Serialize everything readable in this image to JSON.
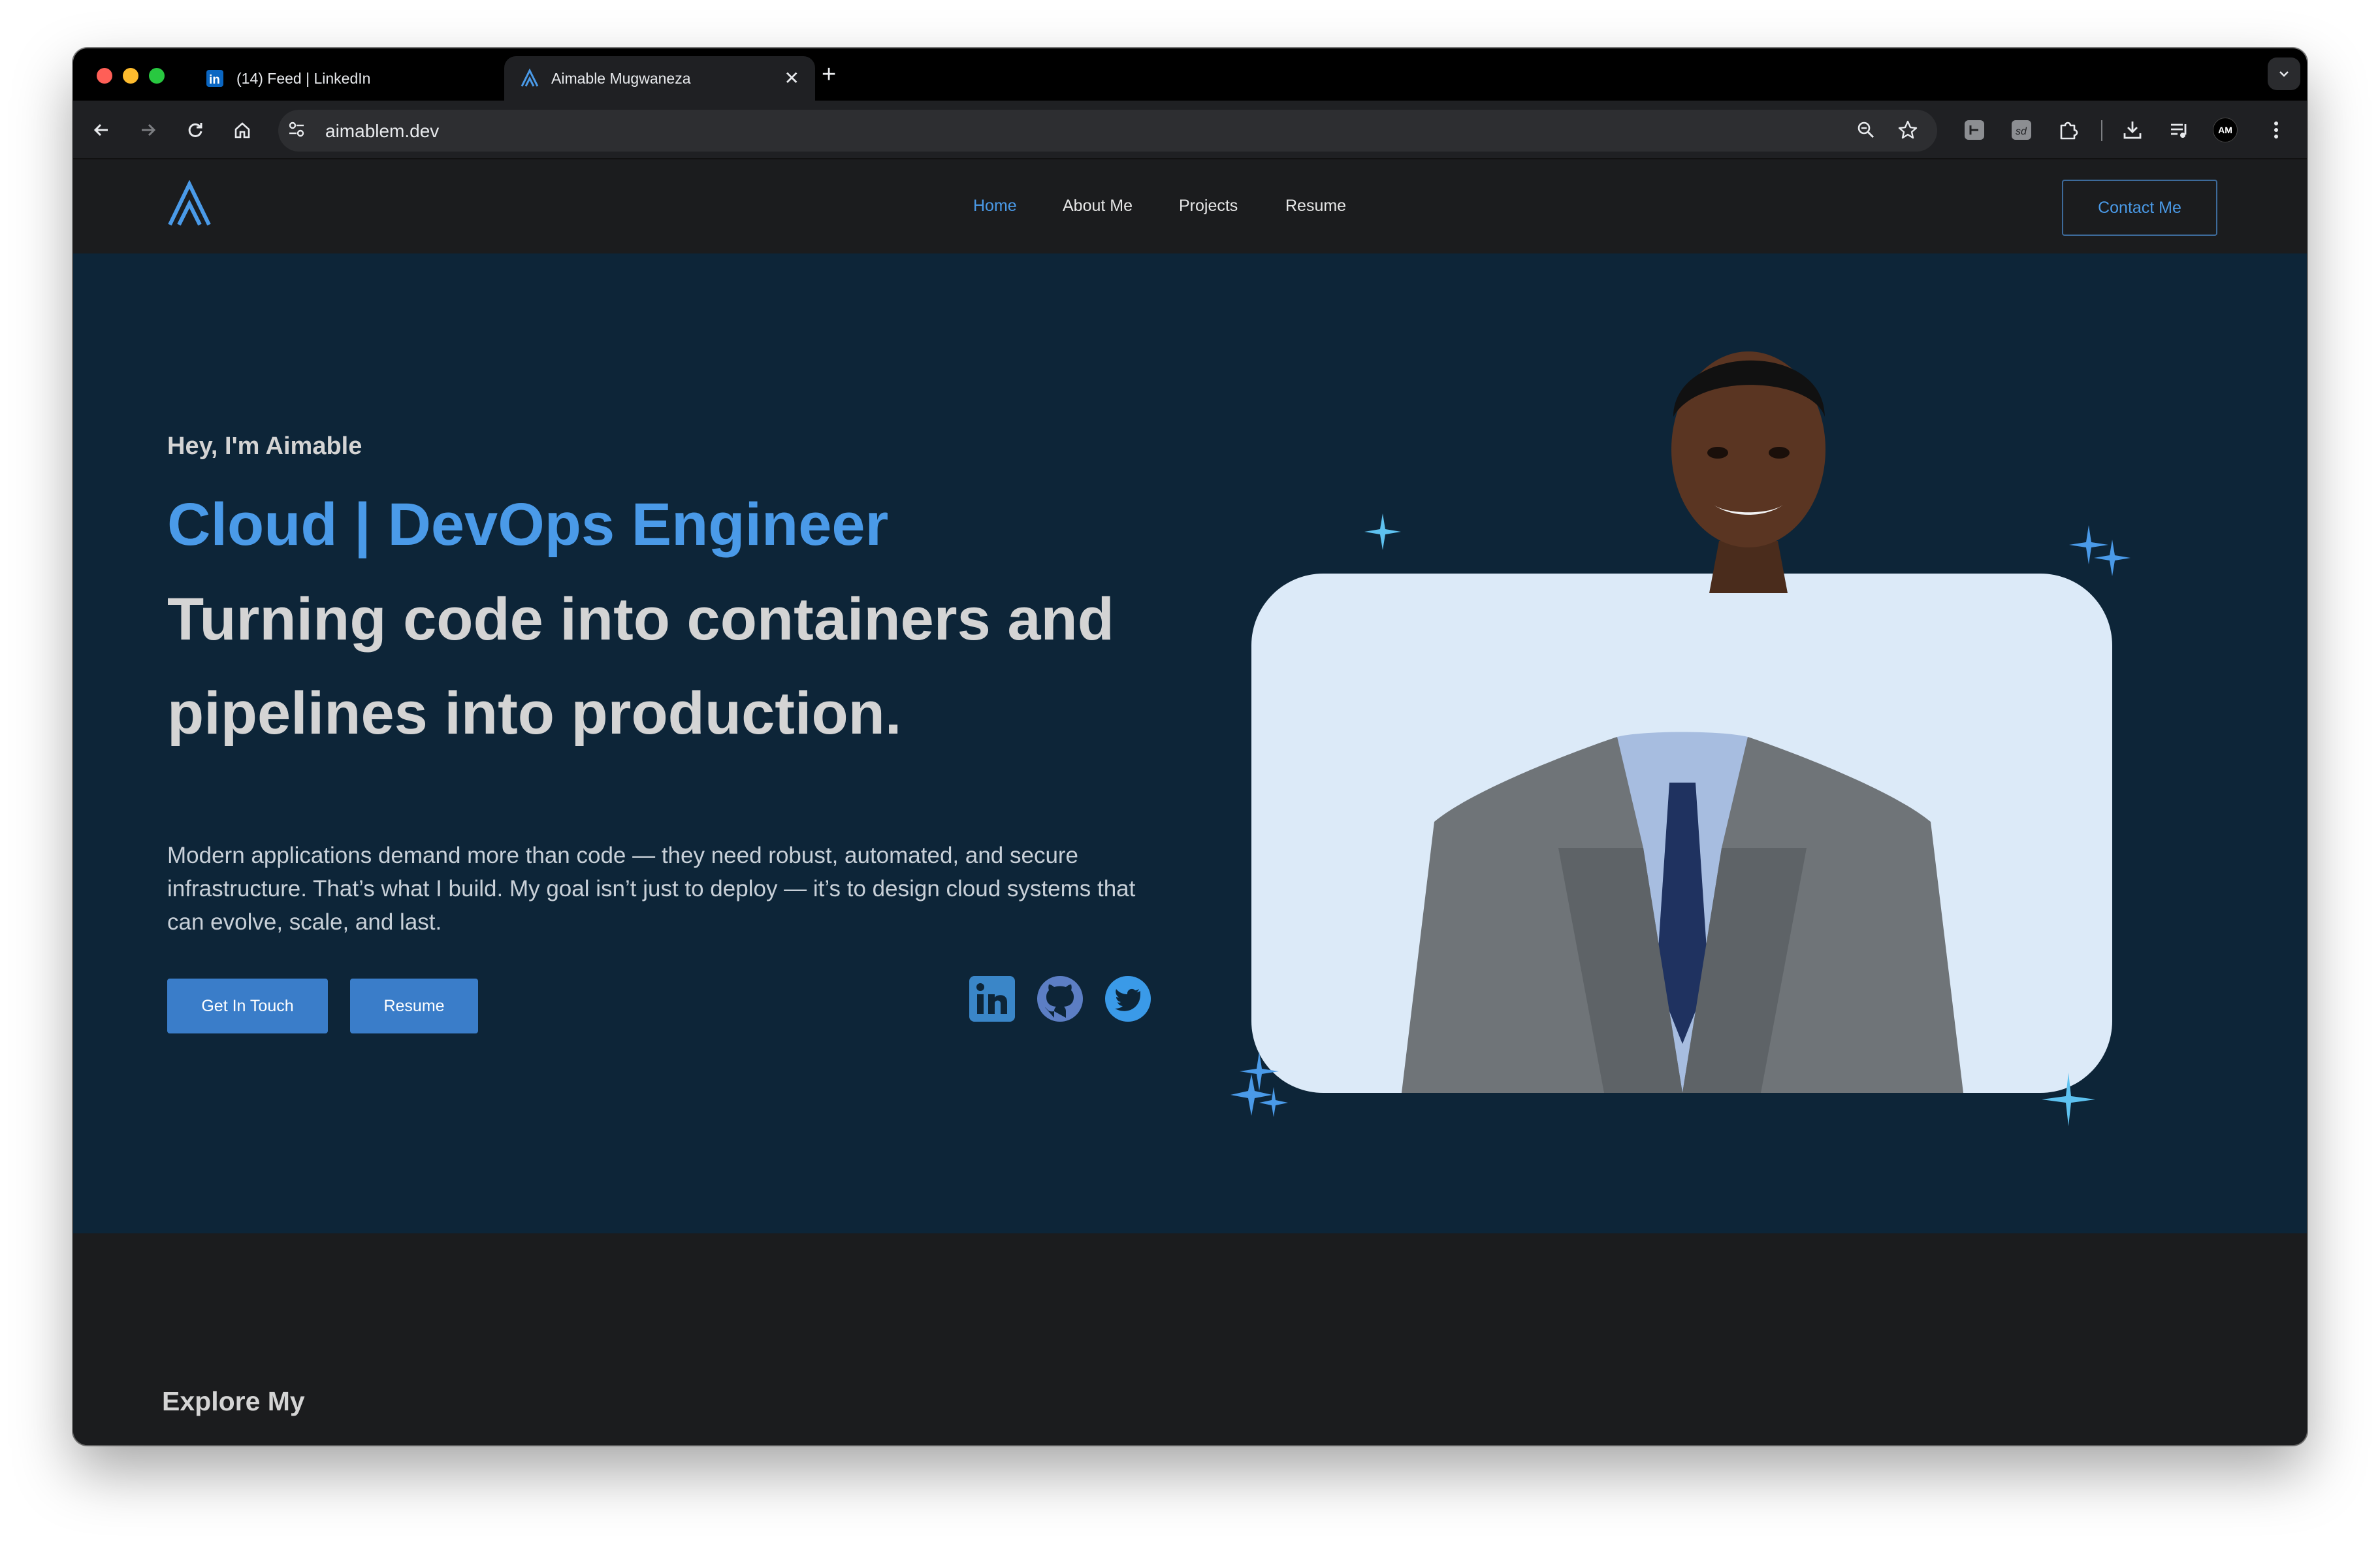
{
  "browser": {
    "tabs": [
      {
        "title": "(14) Feed | LinkedIn",
        "favicon": "linkedin-icon",
        "active": false
      },
      {
        "title": "Aimable Mugwaneza",
        "favicon": "site-logo-icon",
        "active": true
      }
    ],
    "url": "aimablem.dev",
    "profile_initials": "AM",
    "colors": {
      "close": "#ff5f57",
      "minimize": "#febc2e",
      "maximize": "#28c840"
    }
  },
  "site": {
    "nav": {
      "links": [
        "Home",
        "About Me",
        "Projects",
        "Resume"
      ],
      "active": "Home",
      "contact_label": "Contact Me"
    },
    "hero": {
      "greeting": "Hey, I'm Aimable",
      "role": "Cloud | DevOps Engineer",
      "headline_line1": "Turning code into containers and",
      "headline_line2": "pipelines into production.",
      "description": "Modern applications demand more than code — they need robust, automated, and secure infrastructure. That’s what I build. My goal isn’t just to deploy — it’s to design cloud systems that can evolve, scale, and last.",
      "buttons": {
        "get_in_touch": "Get In Touch",
        "resume": "Resume"
      },
      "social_icons": [
        "linkedin-icon",
        "github-icon",
        "twitter-icon"
      ]
    },
    "section_heading": "Explore My",
    "colors": {
      "accent": "#4a9ae8",
      "hero_bg": "#0d2538",
      "page_bg": "#1b1c1e",
      "card_bg": "#dceaf8",
      "button": "#3a7dc9"
    }
  }
}
